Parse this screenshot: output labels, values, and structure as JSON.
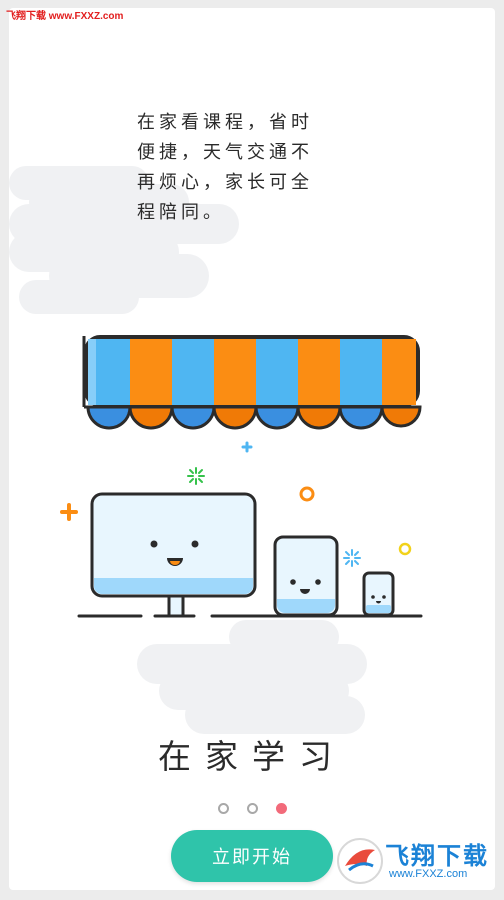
{
  "watermark": {
    "top_text": "飞翔下载 www.FXXZ.com",
    "logo_text": "飞翔下载",
    "logo_url": "www.FXXZ.com"
  },
  "intro": {
    "lines": [
      "在家看课程，省时",
      "便捷，天气交通不",
      "再烦心，家长可全",
      "程陪同。"
    ]
  },
  "heading": "在家学习",
  "pager": {
    "count": 3,
    "active_index": 2
  },
  "start_button": {
    "label": "立即开始"
  },
  "colors": {
    "accent": "#2fc4aa",
    "dot_active": "#f26a7a",
    "stripe_blue": "#4fb6f2",
    "stripe_orange": "#fb8d13"
  },
  "icons": [
    "awning-illustration",
    "monitor-illustration",
    "tablet-illustration",
    "phone-illustration"
  ]
}
